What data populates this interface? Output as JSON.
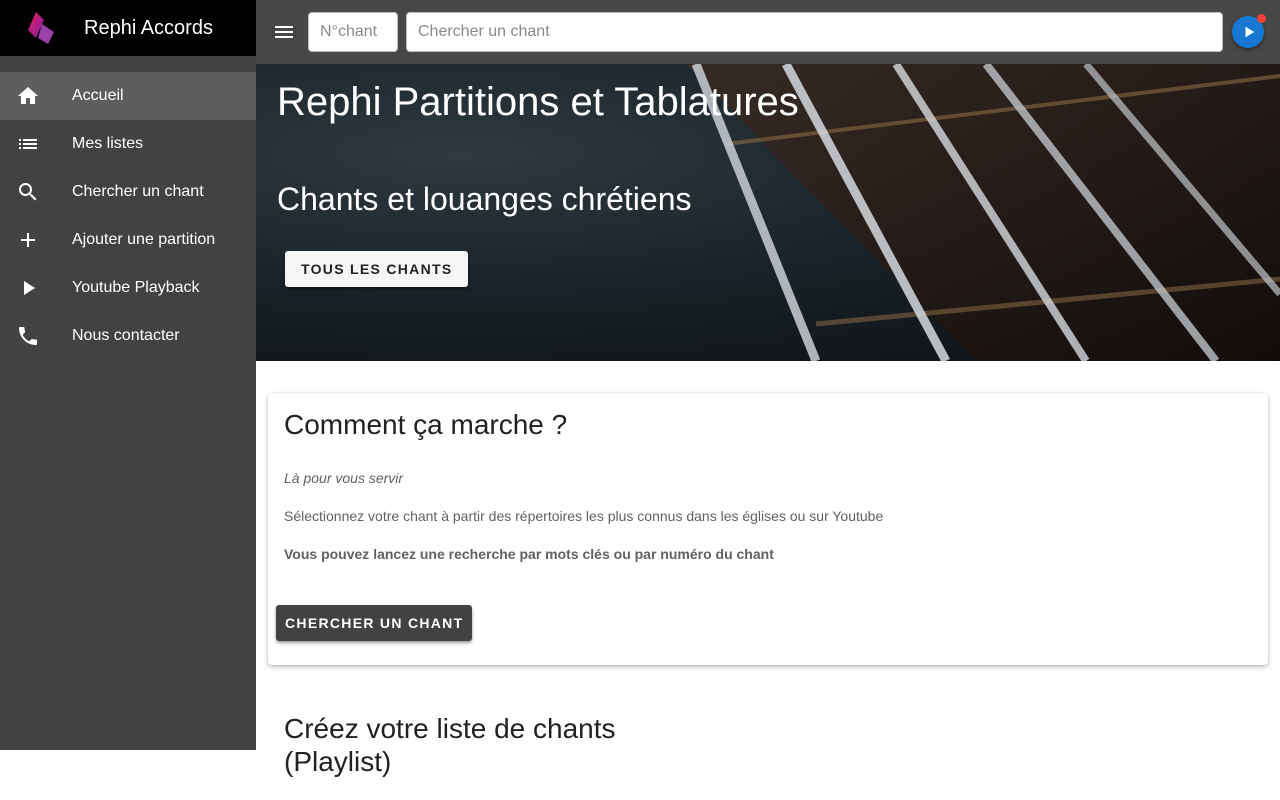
{
  "app": {
    "title": "Rephi Accords",
    "logo_icon": "rephi-logo-icon"
  },
  "sidebar": {
    "items": [
      {
        "label": "Accueil",
        "icon": "home-icon",
        "active": true
      },
      {
        "label": "Mes listes",
        "icon": "list-icon"
      },
      {
        "label": "Chercher un chant",
        "icon": "search-icon"
      },
      {
        "label": "Ajouter une partition",
        "icon": "plus-icon"
      },
      {
        "label": "Youtube Playback",
        "icon": "play-icon"
      },
      {
        "label": "Nous contacter",
        "icon": "phone-icon"
      }
    ]
  },
  "topbar": {
    "menu_icon": "menu-icon",
    "number_placeholder": "N°chant",
    "search_placeholder": "Chercher un chant",
    "play_icon": "play-circle-icon"
  },
  "hero": {
    "title": "Rephi Partitions et Tablatures",
    "subtitle": "Chants et louanges chrétiens",
    "button_label": "TOUS LES CHANTS"
  },
  "card": {
    "title": "Comment ça marche ?",
    "italic_line": "Là pour vous servir",
    "line": "Sélectionnez votre chant à partir des répertoires les plus connus dans les églises ou sur Youtube",
    "bold_line": "Vous pouvez lancez une recherche par mots clés ou par numéro du chant",
    "button_label": "CHERCHER UN CHANT"
  },
  "section2": {
    "title_line1": "Créez votre liste de chants",
    "title_line2": "(Playlist)"
  },
  "colors": {
    "accent": "#1976d2",
    "sidebar_bg": "#424242",
    "topbar_bg": "#474747",
    "notification": "#f44336"
  }
}
